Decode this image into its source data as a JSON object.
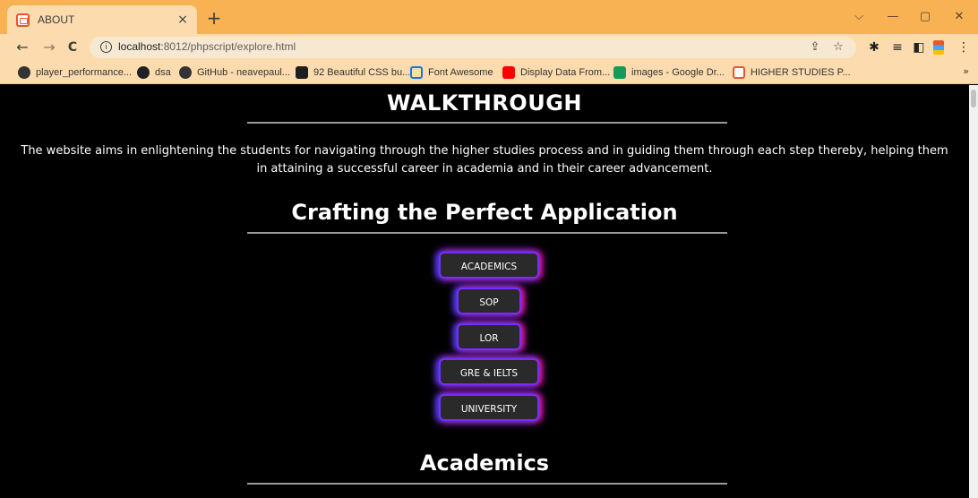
{
  "browser": {
    "tab_title": "ABOUT",
    "tab_close": "×",
    "new_tab": "+",
    "window_controls": {
      "dropdown": "⌵",
      "minimize": "—",
      "restore": "▢",
      "close": "✕"
    },
    "nav": {
      "back": "←",
      "forward": "→",
      "reload": "C"
    },
    "url_host": "localhost",
    "url_rest": ":8012/phpscript/explore.html",
    "omnibox_icons": {
      "info": "i",
      "share": "⇪",
      "bookmark_star": "☆"
    },
    "toolbar_icons": {
      "extensions": "✱",
      "reading_list": "≡",
      "side_panel": "◧",
      "menu": "⋮"
    },
    "bookmarks": [
      {
        "label": "player_performance...",
        "icon": "github-icon",
        "color": "#333333"
      },
      {
        "label": "dsa",
        "icon": "globe-icon",
        "color": "#202124"
      },
      {
        "label": "GitHub - neavepaul...",
        "icon": "github-icon",
        "color": "#333333"
      },
      {
        "label": "92 Beautiful CSS bu...",
        "icon": "codepen-icon",
        "color": "#1e1e1e"
      },
      {
        "label": "Font Awesome",
        "icon": "flag-icon",
        "color": "#1a73e8"
      },
      {
        "label": "Display Data From...",
        "icon": "youtube-icon",
        "color": "#ff0000"
      },
      {
        "label": "images - Google Dr...",
        "icon": "google-drive-icon",
        "color": "#0f9d58"
      },
      {
        "label": "HIGHER STUDIES P...",
        "icon": "site-favicon-icon",
        "color": "#e8572b"
      }
    ],
    "bookmarks_more": "»"
  },
  "page": {
    "walkthrough_title": "WALKTHROUGH",
    "intro_text": "The website aims in enlightening the students for navigating through the higher studies process and in guiding them through each step thereby, helping them in attaining a successful career in academia and in their career advancement.",
    "crafting_title": "Crafting the Perfect Application",
    "buttons": [
      "ACADEMICS",
      "SOP",
      "LOR",
      "GRE & IELTS",
      "UNIVERSITY"
    ],
    "academics_title": "Academics"
  },
  "colors": {
    "browser_chrome": "#f9b253",
    "toolbar": "#fcdcae",
    "page_bg": "#000000",
    "button_bg": "#2a2a2a",
    "glow_left": "#3c46ff",
    "glow_right": "#ff1496"
  }
}
